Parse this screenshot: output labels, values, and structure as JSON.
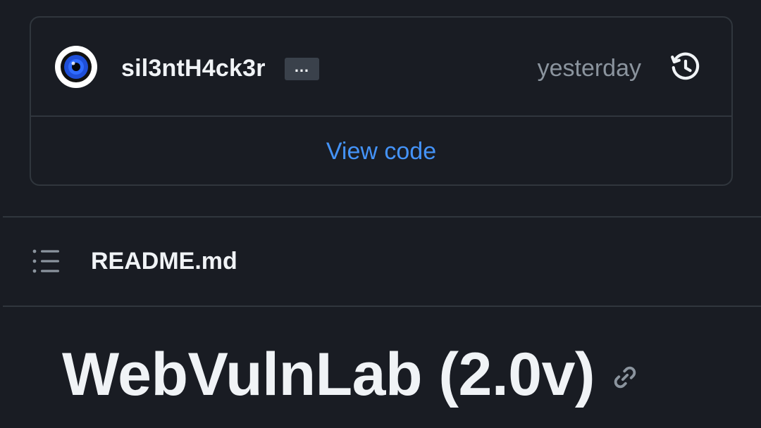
{
  "commit": {
    "author": "sil3ntH4ck3r",
    "more_label": "…",
    "timestamp": "yesterday",
    "avatar_icon": "hacker-eye-avatar",
    "history_icon": "history-icon"
  },
  "view_code": {
    "label": "View code"
  },
  "readme": {
    "toc_icon": "list-icon",
    "filename": "README.md",
    "heading": "WebVulnLab (2.0v)",
    "link_icon": "link-icon"
  },
  "colors": {
    "background": "#191c23",
    "border": "#30363d",
    "text": "#f0f3f6",
    "muted": "#8b949e",
    "accent": "#4493f8"
  }
}
